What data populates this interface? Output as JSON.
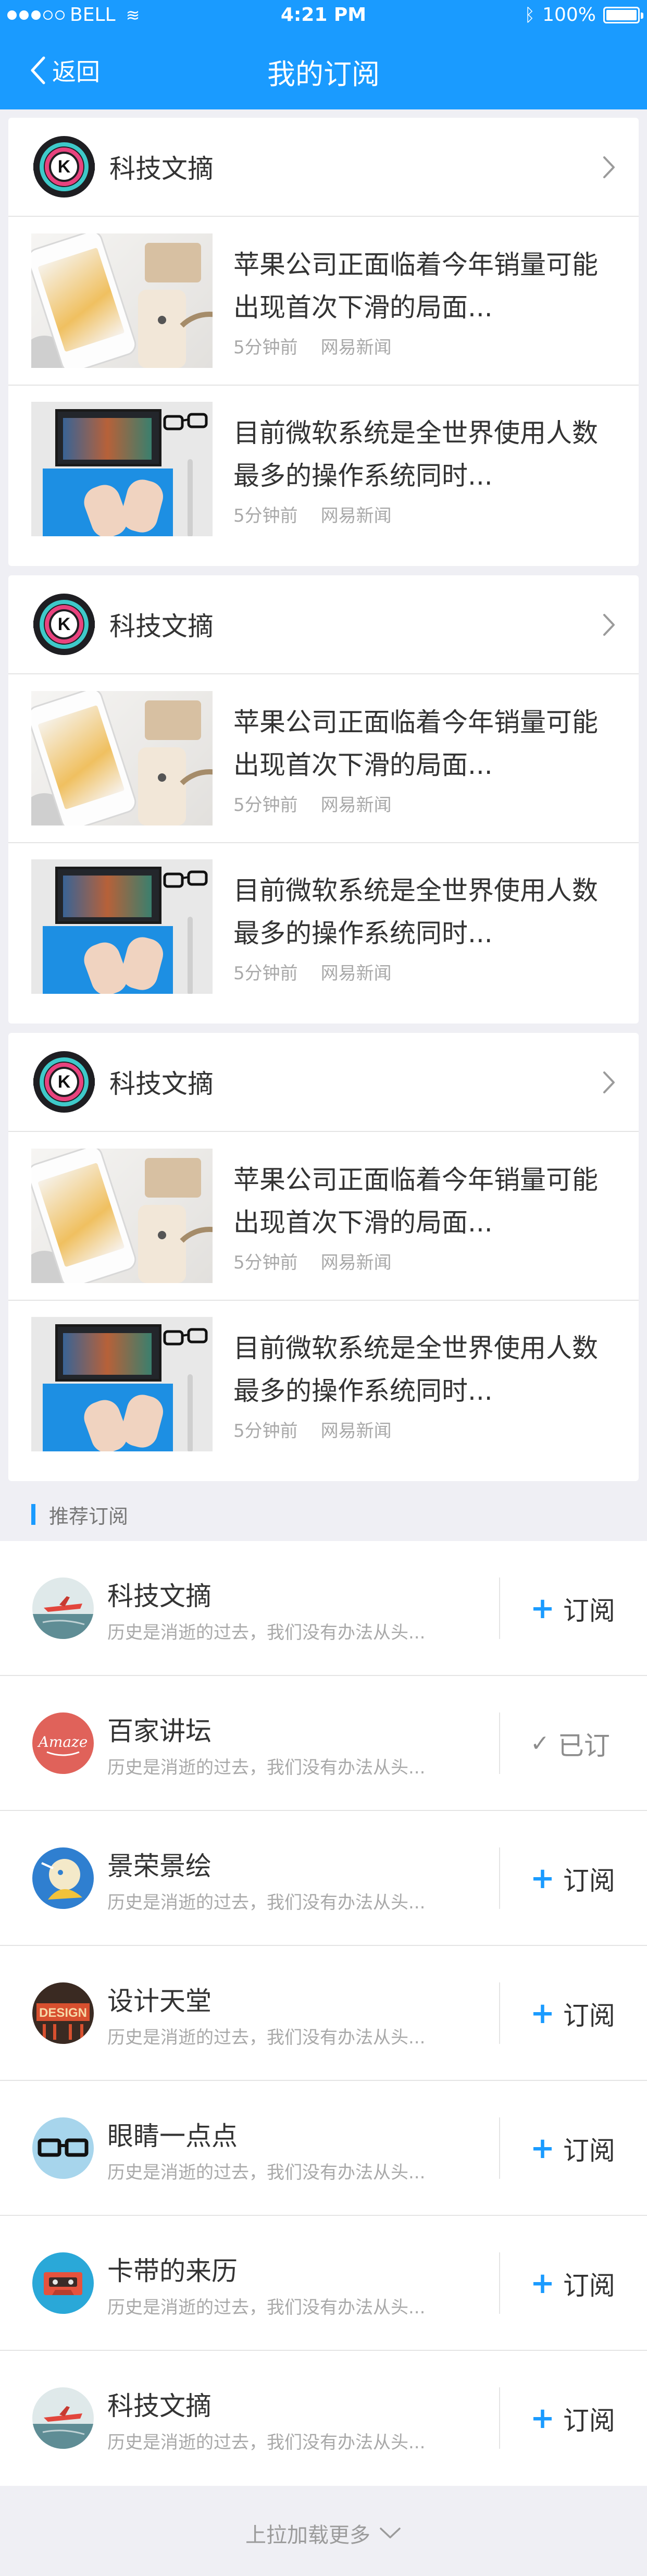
{
  "status_bar": {
    "carrier": "BELL",
    "time": "4:21 PM",
    "battery": "100%",
    "battery_level": 1.0
  },
  "nav": {
    "back_label": "返回",
    "title": "我的订阅"
  },
  "subscriptions": [
    {
      "name": "科技文摘",
      "logo_letter": "K",
      "articles": [
        {
          "title": "苹果公司正面临着今年销量可能出现首次下滑的局面...",
          "time": "5分钟前",
          "source": "网易新闻"
        },
        {
          "title": "目前微软系统是全世界使用人数最多的操作系统同时...",
          "time": "5分钟前",
          "source": "网易新闻"
        }
      ]
    },
    {
      "name": "科技文摘",
      "logo_letter": "K",
      "articles": [
        {
          "title": "苹果公司正面临着今年销量可能出现首次下滑的局面...",
          "time": "5分钟前",
          "source": "网易新闻"
        },
        {
          "title": "目前微软系统是全世界使用人数最多的操作系统同时...",
          "time": "5分钟前",
          "source": "网易新闻"
        }
      ]
    },
    {
      "name": "科技文摘",
      "logo_letter": "K",
      "articles": [
        {
          "title": "苹果公司正面临着今年销量可能出现首次下滑的局面...",
          "time": "5分钟前",
          "source": "网易新闻"
        },
        {
          "title": "目前微软系统是全世界使用人数最多的操作系统同时...",
          "time": "5分钟前",
          "source": "网易新闻"
        }
      ]
    }
  ],
  "recommend": {
    "header": "推荐订阅",
    "items": [
      {
        "name": "科技文摘",
        "desc": "历史是消逝的过去，我们没有办法从头...",
        "button": "订阅",
        "subscribed": false,
        "avatar_icon": "airplane-avatar-icon"
      },
      {
        "name": "百家讲坛",
        "desc": "历史是消逝的过去，我们没有办法从头...",
        "button": "已订",
        "subscribed": true,
        "avatar_icon": "amaze-badge-avatar-icon"
      },
      {
        "name": "景荣景绘",
        "desc": "历史是消逝的过去，我们没有办法从头...",
        "button": "订阅",
        "subscribed": false,
        "avatar_icon": "illustration-avatar-icon"
      },
      {
        "name": "设计天堂",
        "desc": "历史是消逝的过去，我们没有办法从头...",
        "button": "订阅",
        "subscribed": false,
        "avatar_icon": "design-poster-avatar-icon"
      },
      {
        "name": "眼睛一点点",
        "desc": "历史是消逝的过去，我们没有办法从头...",
        "button": "订阅",
        "subscribed": false,
        "avatar_icon": "glasses-avatar-icon"
      },
      {
        "name": "卡带的来历",
        "desc": "历史是消逝的过去，我们没有办法从头...",
        "button": "订阅",
        "subscribed": false,
        "avatar_icon": "cassette-avatar-icon"
      },
      {
        "name": "科技文摘",
        "desc": "历史是消逝的过去，我们没有办法从头...",
        "button": "订阅",
        "subscribed": false,
        "avatar_icon": "airplane-avatar-icon"
      }
    ]
  },
  "load_more": "上拉加载更多",
  "colors": {
    "accent": "#1a9bff",
    "background": "#efeff4",
    "meta_text": "#a9a9a9"
  }
}
